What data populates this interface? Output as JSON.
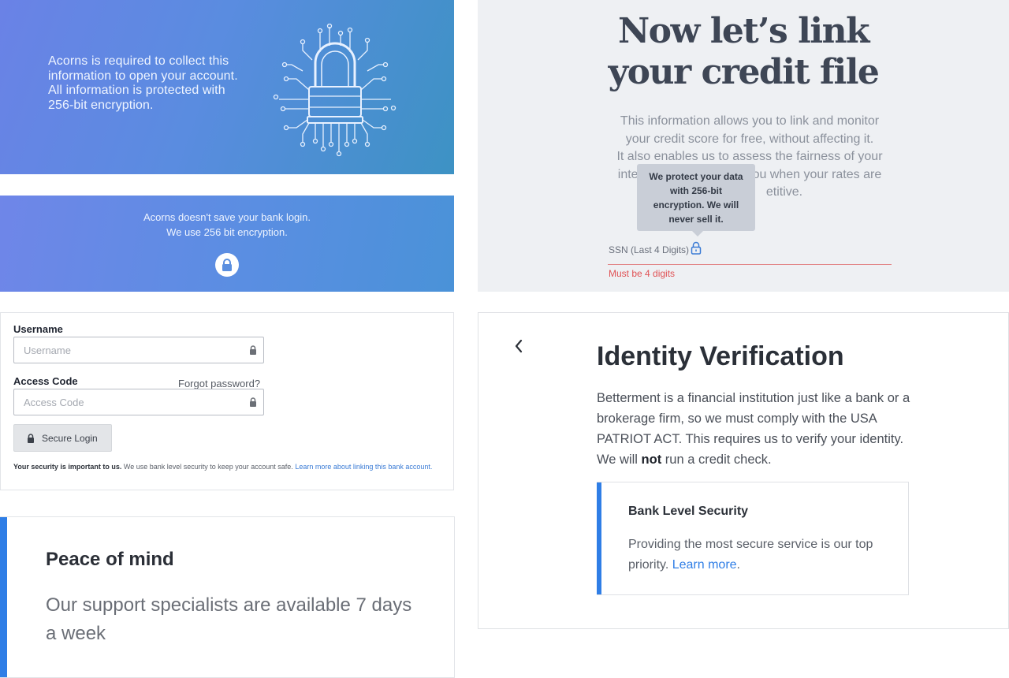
{
  "acorns_banner": {
    "lines": [
      "Acorns is required to collect this",
      "information to open your account.",
      "All information is protected with",
      "256-bit encryption."
    ]
  },
  "bank_banner": {
    "line1": "Acorns doesn't save your bank login.",
    "line2": "We use 256 bit encryption."
  },
  "login": {
    "username_label": "Username",
    "username_placeholder": "Username",
    "access_code_label": "Access Code",
    "forgot_password": "Forgot password?",
    "access_code_placeholder": "Access Code",
    "secure_login_label": "Secure Login",
    "security_note_bold": "Your security is important to us.",
    "security_note_text": " We use bank level security to keep your account safe. ",
    "security_note_link": "Learn more about linking this bank account."
  },
  "peace": {
    "title": "Peace of mind",
    "body": "Our support specialists are available 7 days a week"
  },
  "credit": {
    "title_line1": "Now let’s link",
    "title_line2": "your credit file",
    "desc_line1": "This information allows you to link and monitor",
    "desc_line2": "your credit score for free, without affecting it.",
    "desc_line3": "It also enables us to assess the fairness of your",
    "desc_line4": "inte",
    "desc_line4b": "ou when your rates are",
    "desc_line5": "etitive.",
    "tooltip_lines": [
      "We protect your data",
      "with 256-bit",
      "encryption. We will",
      "never sell it."
    ],
    "ssn_label": "SSN (Last 4 Digits)",
    "ssn_error": "Must be 4 digits"
  },
  "identity": {
    "title": "Identity Verification",
    "body_before": "Betterment is a financial institution just like a bank or a brokerage firm, so we must comply with the USA PATRIOT ACT. This requires us to verify your identity. We will ",
    "body_bold": "not",
    "body_after": " run a credit check.",
    "security_title": "Bank Level Security",
    "security_body": "Providing the most secure service is our top priority. ",
    "security_link": "Learn more",
    "security_after": "."
  },
  "colors": {
    "accent_blue": "#2f7ee6",
    "banner_gradient_start": "#6a82e6",
    "banner_gradient_end": "#3d92c4",
    "error_red": "#e05255",
    "link_blue": "#3a7bd5"
  },
  "icons": [
    "circuit-lock-icon",
    "lock-icon",
    "chevron-left-icon"
  ]
}
